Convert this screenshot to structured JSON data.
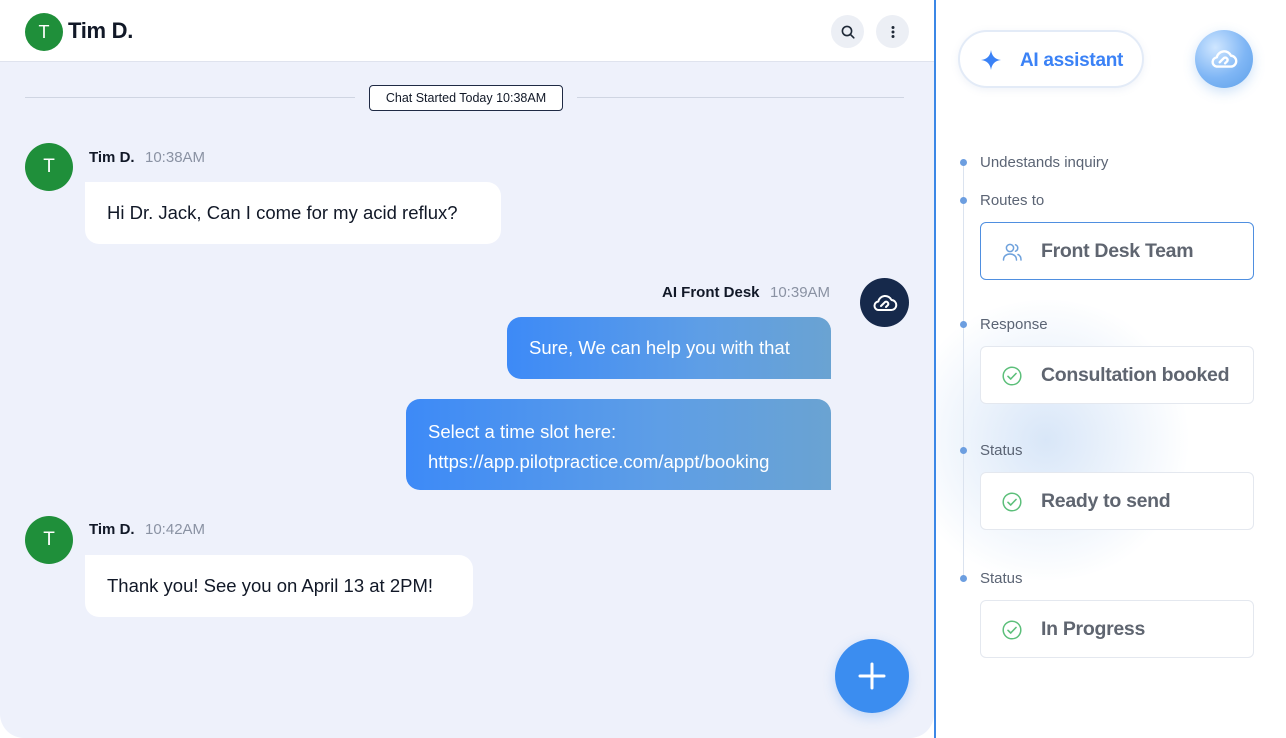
{
  "header": {
    "avatar_initial": "T",
    "contact_name": "Tim D."
  },
  "chat": {
    "started_label": "Chat Started Today 10:38AM",
    "messages": [
      {
        "avatar_initial": "T",
        "sender": "Tim D.",
        "time": "10:38AM",
        "text": "Hi Dr. Jack, Can I come for my acid reflux?"
      },
      {
        "sender": "AI Front Desk",
        "time": "10:39AM",
        "text": "Sure, We can help you with that"
      },
      {
        "line1": "Select a time slot here:",
        "line2": "https://app.pilotpractice.com/appt/booking"
      },
      {
        "avatar_initial": "T",
        "sender": "Tim D.",
        "time": "10:42AM",
        "text": "Thank you! See you on April 13 at 2PM!"
      }
    ]
  },
  "assistant": {
    "button_label": "AI assistant",
    "steps": [
      {
        "label": "Undestands inquiry"
      },
      {
        "label": "Routes to",
        "card": "Front Desk Team",
        "icon": "users-icon"
      },
      {
        "label": "Response",
        "card": "Consultation booked",
        "icon": "check-circle-icon"
      },
      {
        "label": "Status",
        "card": "Ready to send",
        "icon": "check-circle-icon"
      },
      {
        "label": "Status",
        "card": "In Progress",
        "icon": "check-circle-icon"
      }
    ]
  },
  "colors": {
    "accent": "#3b82f6",
    "avatar_green": "#1f8f3a",
    "ai_avatar_bg": "#16294b",
    "check_green": "#5cbf7a"
  }
}
